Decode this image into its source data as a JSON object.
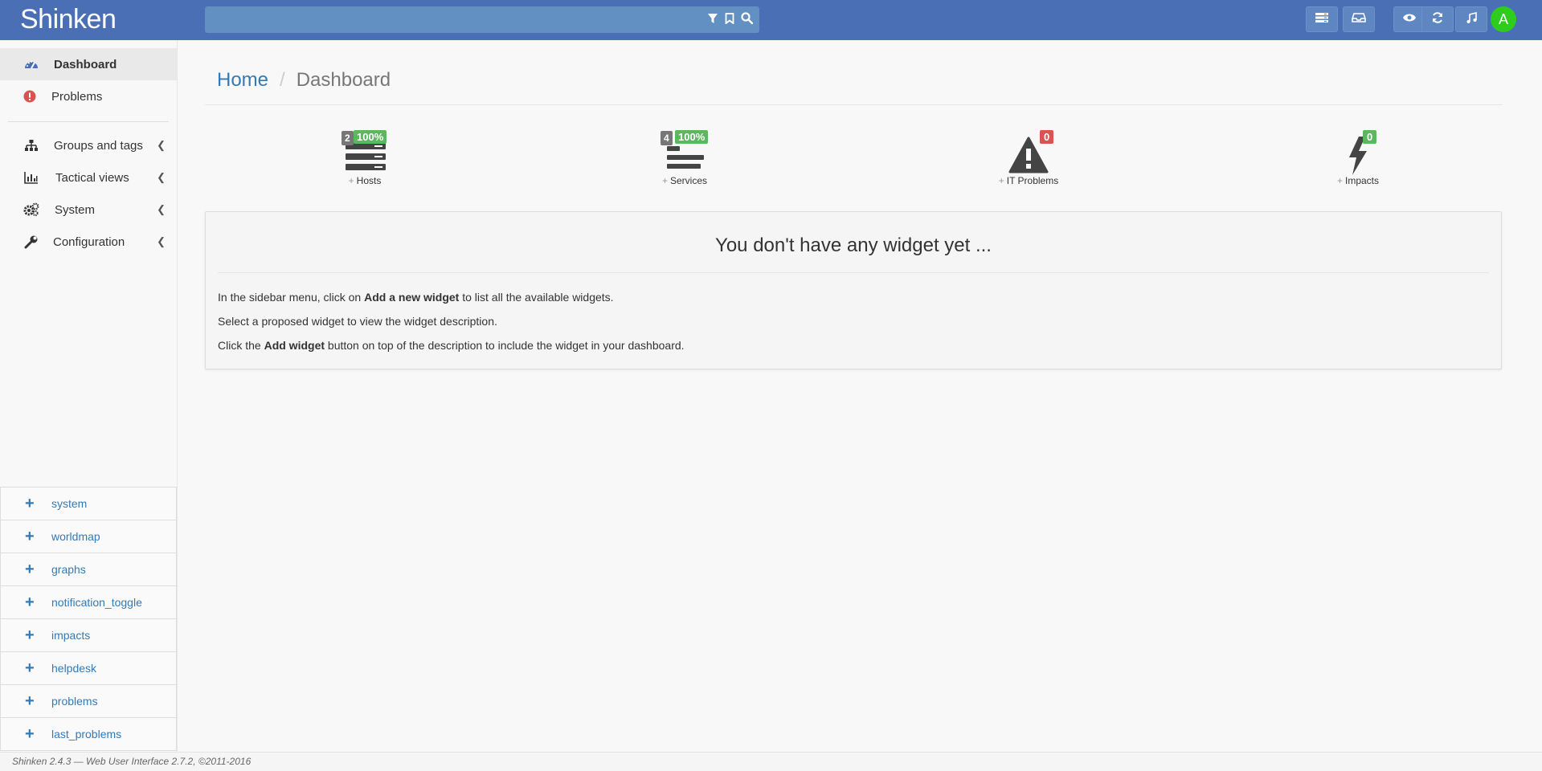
{
  "navbar": {
    "brand": "Shinken",
    "search_placeholder": "",
    "avatar_letter": "A",
    "colors": {
      "background": "#4a6fb5",
      "avatar": "#2ecc1c"
    }
  },
  "sidebar": {
    "items": [
      {
        "label": "Dashboard",
        "icon": "dashboard-icon",
        "active": true
      },
      {
        "label": "Problems",
        "icon": "exclamation-circle-icon"
      },
      {
        "label": "Groups and tags",
        "icon": "sitemap-icon"
      },
      {
        "label": "Tactical views",
        "icon": "bar-chart-icon"
      },
      {
        "label": "System",
        "icon": "gears-icon"
      },
      {
        "label": "Configuration",
        "icon": "wrench-icon"
      }
    ],
    "widgets": [
      "system",
      "worldmap",
      "graphs",
      "notification_toggle",
      "impacts",
      "helpdesk",
      "problems",
      "last_problems"
    ]
  },
  "breadcrumb": {
    "home": "Home",
    "current": "Dashboard"
  },
  "stats": {
    "hosts": {
      "count": "2",
      "pct": "100%",
      "label": "Hosts"
    },
    "services": {
      "count": "4",
      "pct": "100%",
      "label": "Services"
    },
    "it_problems": {
      "count": "0",
      "label": "IT Problems"
    },
    "impacts": {
      "count": "0",
      "label": "Impacts"
    }
  },
  "panel": {
    "title": "You don't have any widget yet ...",
    "line1": {
      "pre": "In the sidebar menu, click on ",
      "bold": "Add a new widget",
      "post": " to list all the available widgets."
    },
    "line2": "Select a proposed widget to view the widget description.",
    "line3": {
      "pre": "Click the ",
      "bold": "Add widget",
      "post": " button on top of the description to include the widget in your dashboard."
    }
  },
  "footer": "Shinken 2.4.3 — Web User Interface 2.7.2, ©2011-2016"
}
